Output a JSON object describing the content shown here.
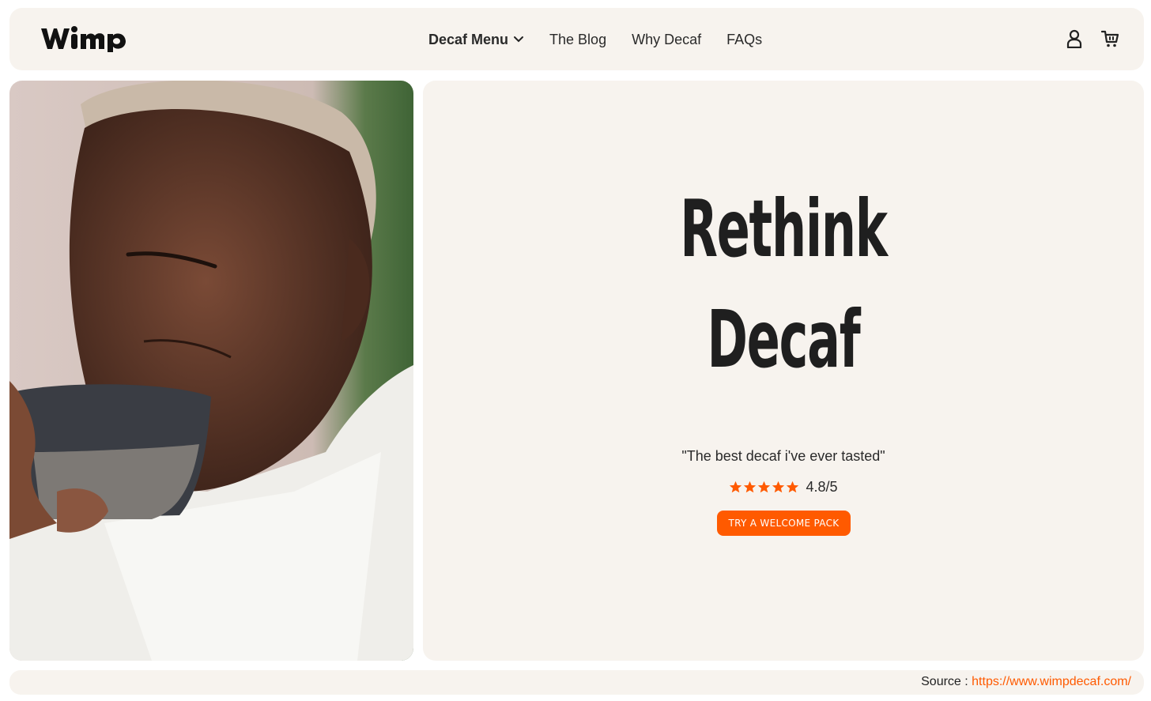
{
  "header": {
    "logo_text": "WiMP",
    "nav": [
      {
        "label": "Decaf Menu"
      },
      {
        "label": "The Blog"
      },
      {
        "label": "Why Decaf"
      },
      {
        "label": "FAQs"
      }
    ],
    "icons": [
      "user-icon",
      "cart-icon"
    ]
  },
  "hero": {
    "title_line1": "Rethink",
    "title_line2": "Decaf",
    "quote": "\"The best decaf i've ever tasted\"",
    "rating": {
      "value": 4.8,
      "text": "4.8/5",
      "stars": 5
    },
    "cta_label": "TRY A WELCOME PACK"
  },
  "footer": {
    "source_label": "Source : ",
    "source_url": "https://www.wimpdecaf.com/"
  },
  "colors": {
    "accent": "#ff5a00",
    "panel": "#f7f3ee",
    "text": "#1f1f1f"
  }
}
